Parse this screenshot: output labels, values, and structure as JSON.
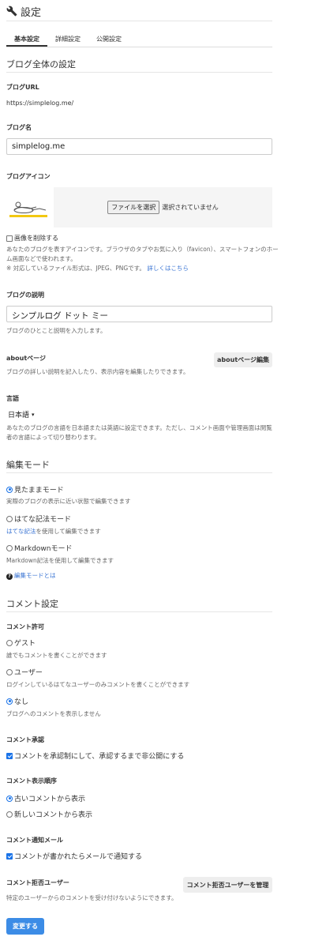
{
  "page": {
    "title": "設定"
  },
  "tabs": [
    {
      "label": "基本設定",
      "active": true
    },
    {
      "label": "詳細設定",
      "active": false
    },
    {
      "label": "公開設定",
      "active": false
    }
  ],
  "blog_settings": {
    "section_title": "ブログ全体の設定",
    "url_label": "ブログURL",
    "url_value": "https://simplelog.me/",
    "name_label": "ブログ名",
    "name_value": "simplelog.me",
    "icon_label": "ブログアイコン",
    "file_button": "ファイルを選択",
    "file_status": "選択されていません",
    "delete_image_label": "画像を削除する",
    "icon_help_1": "あなたのブログを表すアイコンです。ブラウザのタブやお気に入り（favicon）、スマートフォンのホー",
    "icon_help_2": "ム画面などで使われます。",
    "icon_help_3": "※ 対応しているファイル形式は、JPEG、PNGです。",
    "icon_help_link": "詳しくはこちら",
    "desc_label": "ブログの説明",
    "desc_value": "シンプルログ ドット ミー",
    "desc_help": "ブログのひとこと説明を入力します。",
    "about_label": "aboutページ",
    "about_help": "ブログの詳しい説明を記入したり、表示内容を編集したりできます。",
    "about_button": "aboutページ編集",
    "lang_label": "言語",
    "lang_value": "日本語",
    "lang_help_1": "あなたのブログの言語を日本語または英語に設定できます。ただし、コメント画面や管理画面は閲覧",
    "lang_help_2": "者の言語によって切り替わります。"
  },
  "edit_mode": {
    "section_title": "編集モード",
    "options": [
      {
        "label": "見たままモード",
        "selected": true,
        "help": "実際のブログの表示に近い状態で編集できます"
      },
      {
        "label": "はてな記法モード",
        "selected": false,
        "help_link": "はてな記法",
        "help": "を使用して編集できます"
      },
      {
        "label": "Markdownモード",
        "selected": false,
        "help": "Markdown記法を使用して編集できます"
      }
    ],
    "about_link": "編集モードとは"
  },
  "comment_settings": {
    "section_title": "コメント設定",
    "permission_label": "コメント許可",
    "permission_options": [
      {
        "label": "ゲスト",
        "selected": false,
        "help": "誰でもコメントを書くことができます"
      },
      {
        "label": "ユーザー",
        "selected": false,
        "help": "ログインしているはてなユーザーのみコメントを書くことができます"
      },
      {
        "label": "なし",
        "selected": true,
        "help": "ブログへのコメントを表示しません"
      }
    ],
    "approval_label": "コメント承認",
    "approval_checkbox": "コメントを承認制にして、承認するまで非公開にする",
    "approval_checked": true,
    "order_label": "コメント表示順序",
    "order_options": [
      {
        "label": "古いコメントから表示",
        "selected": true
      },
      {
        "label": "新しいコメントから表示",
        "selected": false
      }
    ],
    "notify_label": "コメント通知メール",
    "notify_checkbox": "コメントが書かれたらメールで通知する",
    "notify_checked": true,
    "block_label": "コメント拒否ユーザー",
    "block_help": "特定のユーザーからのコメントを受け付けないようにできます。",
    "block_button": "コメント拒否ユーザーを管理"
  },
  "save_button": "変更する",
  "colors": {
    "accent": "#3c8ce6",
    "link": "#3873d3",
    "radio_blue": "#1a73e8"
  }
}
